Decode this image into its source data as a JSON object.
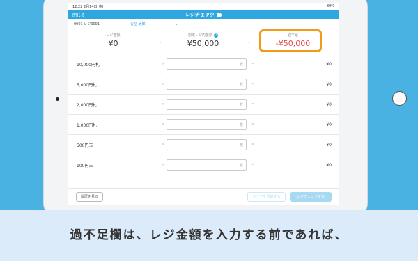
{
  "statusbar": {
    "time": "12:22",
    "date": "2月14日(金)",
    "battery": "80%"
  },
  "navbar": {
    "close": "閉じる",
    "title": "レジチェック",
    "help": "?"
  },
  "subbar": {
    "register": "0001 レジ0001",
    "staff": "青空 太郎"
  },
  "summary": {
    "register_amount_label": "レジ金額",
    "register_amount": "¥0",
    "expected_label": "想定レジ内金額",
    "expected_amount": "¥50,000",
    "diff_label": "過不足",
    "diff_amount": "-¥50,000",
    "dash": "-"
  },
  "rows": [
    {
      "label": "10,000円札",
      "unit": "枚",
      "total": "¥0"
    },
    {
      "label": "5,000円札",
      "unit": "枚",
      "total": "¥0"
    },
    {
      "label": "2,000円札",
      "unit": "枚",
      "total": "¥0"
    },
    {
      "label": "1,000円札",
      "unit": "枚",
      "total": "¥0"
    },
    {
      "label": "500円玉",
      "unit": "枚",
      "total": "¥0"
    },
    {
      "label": "100円玉",
      "unit": "枚",
      "total": "¥0"
    }
  ],
  "symbols": {
    "times": "×",
    "equals": "="
  },
  "footer": {
    "history": "履歴を見る",
    "clear": "クリアを登録する",
    "check": "レジチェックする"
  },
  "caption": "過不足欄は、レジ金額を入力する前であれば、",
  "colors": {
    "accent": "#2ea7e0",
    "highlight": "#f39a1b",
    "negative": "#e64b4b",
    "background": "#4ab1e3"
  }
}
